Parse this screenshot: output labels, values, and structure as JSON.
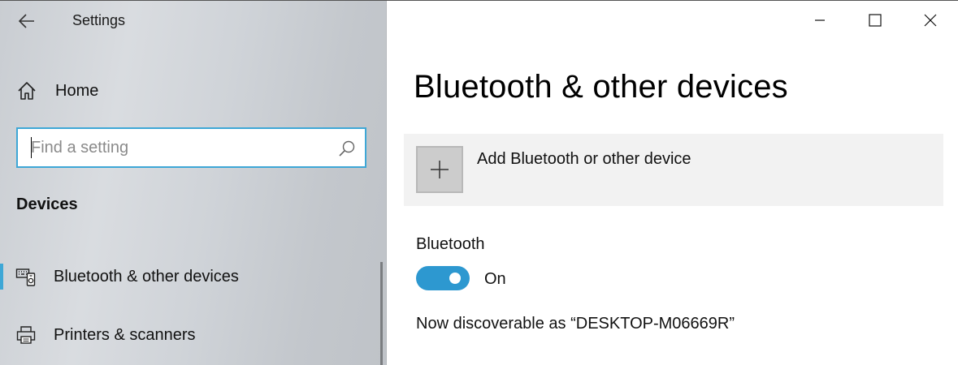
{
  "window": {
    "title": "Settings",
    "controls": {
      "minimize": "minimize-icon",
      "maximize": "maximize-icon",
      "close": "close-icon"
    }
  },
  "sidebar": {
    "home_label": "Home",
    "search": {
      "placeholder": "Find a setting",
      "value": ""
    },
    "section_title": "Devices",
    "items": [
      {
        "label": "Bluetooth & other devices",
        "icon": "bluetooth-devices-icon",
        "active": true
      },
      {
        "label": "Printers & scanners",
        "icon": "printer-icon",
        "active": false
      }
    ]
  },
  "main": {
    "page_title": "Bluetooth & other devices",
    "add_device_label": "Add Bluetooth or other device",
    "bluetooth": {
      "label": "Bluetooth",
      "state_label": "On",
      "enabled": true,
      "discoverable_text": "Now discoverable as “DESKTOP-M06669R”"
    }
  },
  "colors": {
    "accent": "#3ea7d6",
    "toggle_on": "#2d98d0",
    "tile_bg": "#f2f2f2"
  }
}
